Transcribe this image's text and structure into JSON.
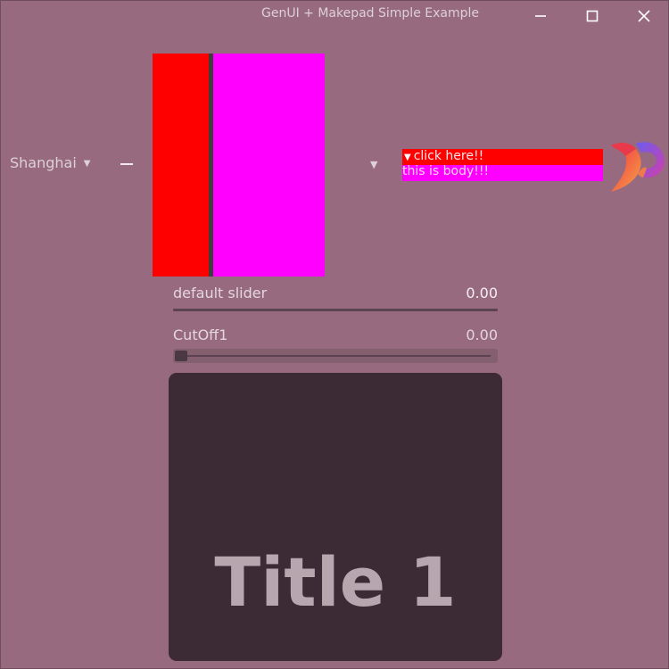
{
  "window": {
    "title": "GenUI + Makepad Simple Example",
    "buttons": {
      "minimize_icon": "minimize-icon",
      "maximize_icon": "maximize-icon",
      "close_icon": "close-icon"
    }
  },
  "dropdown": {
    "selected": "Shanghai",
    "caret": "▼"
  },
  "split": {
    "left_color": "#ff0000",
    "right_color": "#ff00ff"
  },
  "lone_dropdown": {
    "caret": "▼"
  },
  "fold": {
    "header_icon": "▼",
    "header_label": "click here!!",
    "body_text": "this is body!!!"
  },
  "sliders": [
    {
      "label": "default slider",
      "value": "0.00"
    },
    {
      "label": "CutOff1",
      "value": "0.00"
    }
  ],
  "card": {
    "title": "Title 1"
  },
  "colors": {
    "background": "#976a80",
    "card": "#3c2a34",
    "accent_red": "#ff0000",
    "accent_magenta": "#ff00ff"
  }
}
